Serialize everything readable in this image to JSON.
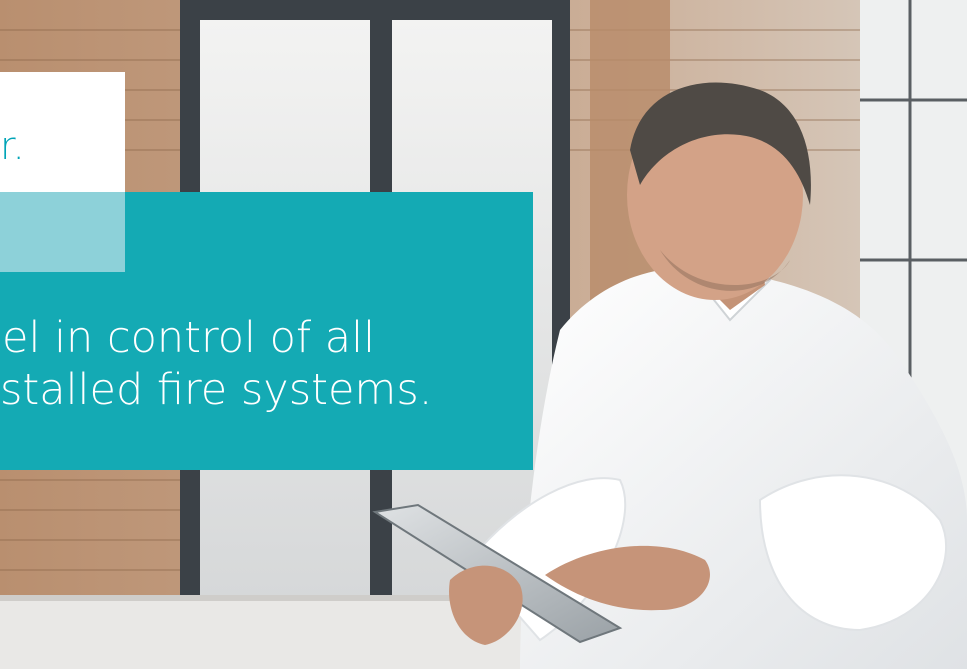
{
  "headline": {
    "partial_top_text": "r.",
    "line1": "el in control of all",
    "line2": "stalled fire systems."
  },
  "colors": {
    "teal": "#14aab4",
    "light_teal": "#8dd1d9",
    "white": "#ffffff",
    "text_teal": "#00a4b7"
  }
}
